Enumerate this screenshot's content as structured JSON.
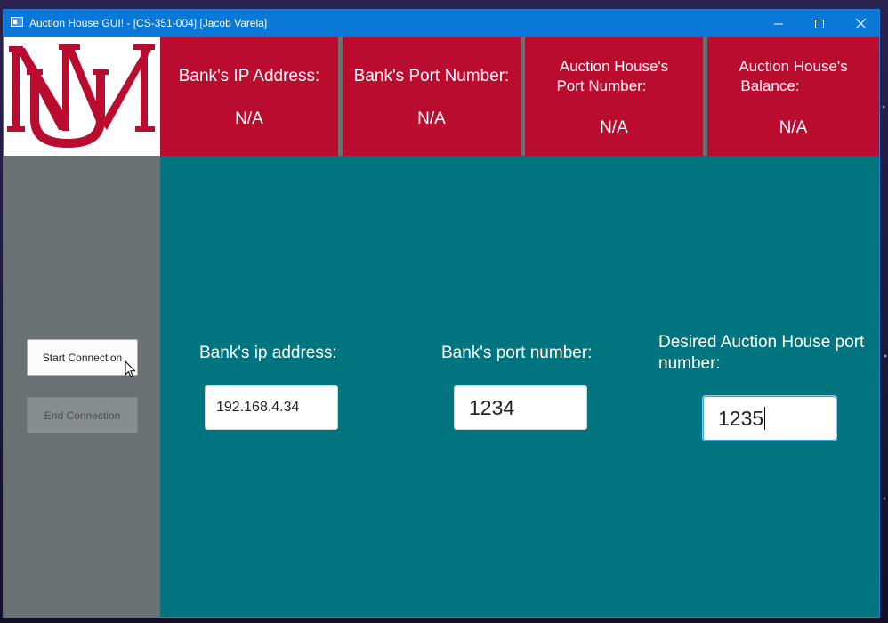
{
  "window": {
    "title": "Auction House GUI! - [CS-351-004] [Jacob Varela]"
  },
  "header": {
    "cells": [
      {
        "label": "Bank's IP Address:",
        "value": "N/A"
      },
      {
        "label": "Bank's Port Number:",
        "value": "N/A"
      },
      {
        "label_line1": "Auction House's",
        "label_line2": "Port Number:",
        "value": "N/A"
      },
      {
        "label_line1": "Auction House's",
        "label_line2": "Balance:",
        "value": "N/A"
      }
    ]
  },
  "sidebar": {
    "start_label": "Start Connection",
    "end_label": "End Connection"
  },
  "form": {
    "bank_ip_label": "Bank's ip address:",
    "bank_ip_value": "192.168.4.34",
    "bank_port_label": "Bank's port number:",
    "bank_port_value": "1234",
    "ah_port_label": "Desired Auction House port number:",
    "ah_port_value": "1235"
  },
  "colors": {
    "titlebar": "#0a78d7",
    "header_red": "#ba0c2f",
    "main_teal": "#007580",
    "sidebar_gray": "#697173"
  }
}
